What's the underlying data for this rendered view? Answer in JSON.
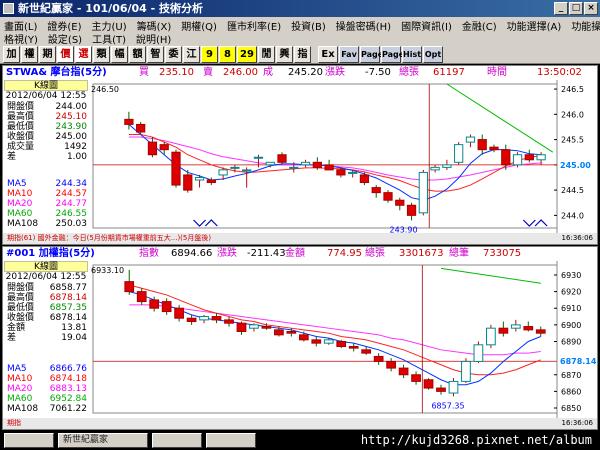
{
  "window": {
    "title": "新世紀贏家 - 101/06/04 - 技術分析"
  },
  "menu": {
    "row1": [
      "畫面(L)",
      "證券(E)",
      "主力(U)",
      "籌碼(X)",
      "期權(Q)",
      "匯市利率(E)",
      "投資(B)",
      "操盤密碼(H)",
      "國際資訊(I)",
      "金融(C)",
      "功能選擇(A)",
      "功能操作(F)"
    ],
    "row2": [
      "格視(Y)",
      "設定(S)",
      "工具(T)",
      "說明(H)"
    ]
  },
  "toolbar": {
    "buttons": [
      "加",
      "權",
      "期",
      "價",
      "選",
      "類",
      "幅",
      "額",
      "智",
      "委",
      "江",
      "9",
      "8",
      "29",
      "閒",
      "興",
      "指",
      "Ex",
      "Fav",
      "Page",
      "Page",
      "Hist",
      "Opt"
    ]
  },
  "chart_data": [
    {
      "type": "candlestick",
      "header": {
        "symbol": "STWA& 摩台指(5分)",
        "buy_label": "買",
        "buy": "235.10",
        "sell_label": "賣",
        "sell": "246.00",
        "last_label": "成",
        "last": "245.20",
        "change_label": "漲跌",
        "change": "-7.50",
        "volume_label": "總張",
        "volume": "61197",
        "time_label": "時間",
        "time": "13:50:02"
      },
      "info": {
        "kbutton": "K線圖",
        "date": "2012/06/04 12:55",
        "rows": [
          {
            "label": "開盤價",
            "value": "244.00"
          },
          {
            "label": "最高價",
            "value": "245.10"
          },
          {
            "label": "最低價",
            "value": "243.90"
          },
          {
            "label": "收盤價",
            "value": "245.00"
          },
          {
            "label": "成交量",
            "value": "1492"
          },
          {
            "label": "差",
            "value": "1.00"
          }
        ],
        "ma": [
          {
            "label": "MA5",
            "value": "244.34",
            "color": "#0000ff"
          },
          {
            "label": "MA10",
            "value": "244.57",
            "color": "#ff0000"
          },
          {
            "label": "MA20",
            "value": "244.77",
            "color": "#ff00ff"
          },
          {
            "label": "MA60",
            "value": "246.55",
            "color": "#00aa00"
          },
          {
            "label": "MA108",
            "value": "250.03",
            "color": "#000000"
          }
        ]
      },
      "y_ticks": [
        "246.5",
        "246.0",
        "245.5",
        "245.00",
        "244.5",
        "244.0"
      ],
      "ylim": [
        243.75,
        246.6
      ],
      "annotations": {
        "high_label": "246.50",
        "low_label": "243.90",
        "current": "245.00"
      },
      "candles": [
        [
          245.9,
          246.05,
          245.7,
          245.8
        ],
        [
          245.8,
          245.85,
          245.6,
          245.65
        ],
        [
          245.45,
          245.55,
          245.15,
          245.2
        ],
        [
          245.4,
          245.45,
          245.2,
          245.3
        ],
        [
          245.25,
          245.3,
          244.55,
          244.6
        ],
        [
          244.8,
          244.9,
          244.45,
          244.5
        ],
        [
          244.7,
          244.8,
          244.55,
          244.75
        ],
        [
          244.7,
          244.75,
          244.6,
          244.65
        ],
        [
          244.8,
          244.95,
          244.7,
          244.9
        ],
        [
          244.95,
          245.0,
          244.85,
          244.95
        ],
        [
          244.9,
          244.95,
          244.55,
          244.9
        ],
        [
          245.15,
          245.2,
          244.95,
          245.15
        ],
        [
          245.0,
          245.05,
          244.95,
          245.05
        ],
        [
          245.2,
          245.25,
          245.0,
          245.05
        ],
        [
          244.95,
          245.05,
          244.85,
          244.95
        ],
        [
          245.0,
          245.1,
          244.95,
          245.05
        ],
        [
          245.05,
          245.15,
          244.9,
          244.95
        ],
        [
          245.0,
          245.1,
          244.9,
          244.9
        ],
        [
          244.9,
          244.95,
          244.75,
          244.8
        ],
        [
          244.85,
          244.9,
          244.75,
          244.85
        ],
        [
          244.8,
          244.85,
          244.6,
          244.65
        ],
        [
          244.55,
          244.6,
          244.35,
          244.45
        ],
        [
          244.45,
          244.5,
          244.25,
          244.3
        ],
        [
          244.3,
          244.35,
          244.1,
          244.2
        ],
        [
          244.2,
          244.25,
          243.9,
          244.0
        ],
        [
          244.05,
          244.9,
          244.0,
          244.85
        ],
        [
          244.9,
          245.0,
          244.85,
          244.95
        ],
        [
          244.95,
          245.1,
          244.9,
          245.0
        ],
        [
          245.05,
          245.45,
          245.0,
          245.4
        ],
        [
          245.45,
          245.6,
          245.35,
          245.55
        ],
        [
          245.5,
          245.6,
          245.2,
          245.3
        ],
        [
          245.35,
          245.4,
          245.25,
          245.3
        ],
        [
          245.3,
          245.4,
          244.9,
          245.0
        ],
        [
          245.0,
          245.25,
          244.95,
          245.2
        ],
        [
          245.2,
          245.3,
          245.05,
          245.1
        ],
        [
          245.1,
          245.25,
          245.0,
          245.2
        ]
      ],
      "ma5": [
        245.8,
        245.6,
        245.4,
        245.2,
        245.0,
        244.85,
        244.78,
        244.7,
        244.72,
        244.78,
        244.83,
        244.9,
        244.98,
        245.02,
        245.02,
        245.0,
        245.0,
        244.98,
        244.94,
        244.89,
        244.82,
        244.74,
        244.62,
        244.5,
        244.35,
        244.3,
        244.38,
        244.52,
        244.74,
        245.03,
        245.22,
        245.3,
        245.3,
        245.28,
        245.22,
        245.2
      ],
      "ma10": [
        245.6,
        245.6,
        245.55,
        245.45,
        245.35,
        245.2,
        245.1,
        245.0,
        244.93,
        244.88,
        244.85,
        244.86,
        244.88,
        244.9,
        244.92,
        244.94,
        244.94,
        244.93,
        244.92,
        244.9,
        244.86,
        244.8,
        244.75,
        244.69,
        244.6,
        244.52,
        244.48,
        244.48,
        244.52,
        244.6,
        244.72,
        244.85,
        244.98,
        245.08,
        245.15,
        245.18
      ],
      "ma20": [
        245.55,
        245.55,
        245.52,
        245.48,
        245.42,
        245.36,
        245.3,
        245.22,
        245.16,
        245.12,
        245.08,
        245.04,
        245.02,
        245.0,
        245.0,
        245.0,
        245.0,
        244.98,
        244.96,
        244.94,
        244.9,
        244.85,
        244.8,
        244.76,
        244.72,
        244.7,
        244.7,
        244.72,
        244.76,
        244.8,
        244.85,
        244.9,
        244.95,
        245.0,
        245.02,
        245.04
      ],
      "ma60_line": [
        [
          27,
          246.6
        ],
        [
          36,
          245.25
        ]
      ],
      "vol_marks": [
        [
          6,
          "down"
        ],
        [
          7,
          "up"
        ],
        [
          34,
          "down"
        ],
        [
          35,
          "up"
        ]
      ],
      "strip": {
        "text": "期指(61) 國外金融：今日(5月份期貨市場權重前五大...)(5月盤後)",
        "time": "16:36:06"
      }
    },
    {
      "type": "candlestick",
      "header": {
        "symbol": "#001 加權指(5分)",
        "idx_label": "指數",
        "idx": "6894.66",
        "change_label": "漲跌",
        "change": "-211.43",
        "amt_label": "金額",
        "amt": "774.95",
        "vol_label": "總張",
        "vol": "3301673",
        "cnt_label": "總筆",
        "cnt": "733075"
      },
      "info": {
        "kbutton": "K線圖",
        "date": "2012/06/04 12:55",
        "rows": [
          {
            "label": "開盤價",
            "value": "6858.77"
          },
          {
            "label": "最高價",
            "value": "6878.14"
          },
          {
            "label": "最低價",
            "value": "6857.35"
          },
          {
            "label": "收盤價",
            "value": "6878.14"
          },
          {
            "label": "金額",
            "value": "13.81"
          },
          {
            "label": "差",
            "value": "19.04"
          }
        ],
        "ma": [
          {
            "label": "MA5",
            "value": "6866.76",
            "color": "#0000ff"
          },
          {
            "label": "MA10",
            "value": "6874.18",
            "color": "#ff0000"
          },
          {
            "label": "MA20",
            "value": "6883.13",
            "color": "#ff00ff"
          },
          {
            "label": "MA60",
            "value": "6952.84",
            "color": "#00aa00"
          },
          {
            "label": "MA108",
            "value": "7061.22",
            "color": "#000000"
          }
        ]
      },
      "y_ticks": [
        "6930",
        "6920",
        "6910",
        "6900",
        "6890",
        "6870",
        "6860",
        "6850"
      ],
      "ylim": [
        6847,
        6936
      ],
      "annotations": {
        "high_label": "6933.10",
        "low_label": "6857.35",
        "current": "6878.14"
      },
      "candles": [
        [
          6926,
          6933,
          6918,
          6920
        ],
        [
          6920,
          6922,
          6912,
          6914
        ],
        [
          6915,
          6917,
          6908,
          6910
        ],
        [
          6914,
          6916,
          6906,
          6908
        ],
        [
          6910,
          6912,
          6902,
          6904
        ],
        [
          6904,
          6906,
          6900,
          6902
        ],
        [
          6903,
          6906,
          6901,
          6905
        ],
        [
          6905,
          6907,
          6901,
          6903
        ],
        [
          6903,
          6905,
          6899,
          6901
        ],
        [
          6901,
          6902,
          6894,
          6896
        ],
        [
          6898,
          6901,
          6896,
          6900
        ],
        [
          6899,
          6901,
          6897,
          6898
        ],
        [
          6897,
          6899,
          6893,
          6894
        ],
        [
          6896,
          6898,
          6893,
          6895
        ],
        [
          6894,
          6896,
          6890,
          6891
        ],
        [
          6891,
          6893,
          6887,
          6889
        ],
        [
          6889,
          6892,
          6888,
          6891
        ],
        [
          6890,
          6891,
          6886,
          6887
        ],
        [
          6887,
          6889,
          6884,
          6886
        ],
        [
          6885,
          6887,
          6882,
          6883
        ],
        [
          6881,
          6883,
          6876,
          6878
        ],
        [
          6878,
          6880,
          6872,
          6874
        ],
        [
          6874,
          6876,
          6868,
          6870
        ],
        [
          6870,
          6872,
          6864,
          6866
        ],
        [
          6867,
          6868,
          6861,
          6862
        ],
        [
          6862,
          6864,
          6858,
          6860
        ],
        [
          6859,
          6868,
          6857,
          6866
        ],
        [
          6866,
          6880,
          6865,
          6878
        ],
        [
          6878,
          6890,
          6877,
          6888
        ],
        [
          6888,
          6900,
          6886,
          6898
        ],
        [
          6898,
          6902,
          6893,
          6895
        ],
        [
          6898,
          6903,
          6896,
          6900
        ],
        [
          6899,
          6902,
          6896,
          6897
        ],
        [
          6897,
          6899,
          6893,
          6895
        ]
      ],
      "ma5": [
        6920,
        6918,
        6915,
        6912,
        6909,
        6906,
        6904,
        6903,
        6902,
        6901,
        6900,
        6899,
        6898,
        6897,
        6895,
        6893,
        6892,
        6890,
        6889,
        6887,
        6885,
        6882,
        6879,
        6875,
        6871,
        6867,
        6864,
        6864,
        6866,
        6871,
        6878,
        6884,
        6890,
        6893
      ],
      "ma10": [
        6924,
        6922,
        6920,
        6918,
        6915,
        6912,
        6909,
        6907,
        6905,
        6903,
        6902,
        6900,
        6899,
        6898,
        6897,
        6896,
        6895,
        6893,
        6892,
        6891,
        6889,
        6887,
        6885,
        6882,
        6879,
        6876,
        6873,
        6871,
        6870,
        6870,
        6871,
        6873,
        6876,
        6879
      ],
      "ma20": [
        6912,
        6912,
        6912,
        6911,
        6910,
        6909,
        6908,
        6907,
        6906,
        6905,
        6904,
        6903,
        6902,
        6901,
        6900,
        6899,
        6898,
        6897,
        6896,
        6895,
        6894,
        6892,
        6891,
        6889,
        6887,
        6885,
        6884,
        6883,
        6882,
        6882,
        6882,
        6883,
        6883,
        6884
      ],
      "ma60_line": [
        [
          25,
          6934
        ],
        [
          33,
          6925
        ]
      ],
      "strip": {
        "text": "期指",
        "time": "16:36:06"
      }
    }
  ],
  "taskbar": {
    "tasks": [
      "新世紀贏家",
      "",
      ""
    ],
    "url": "http://kujd3268.pixnet.net/album"
  }
}
